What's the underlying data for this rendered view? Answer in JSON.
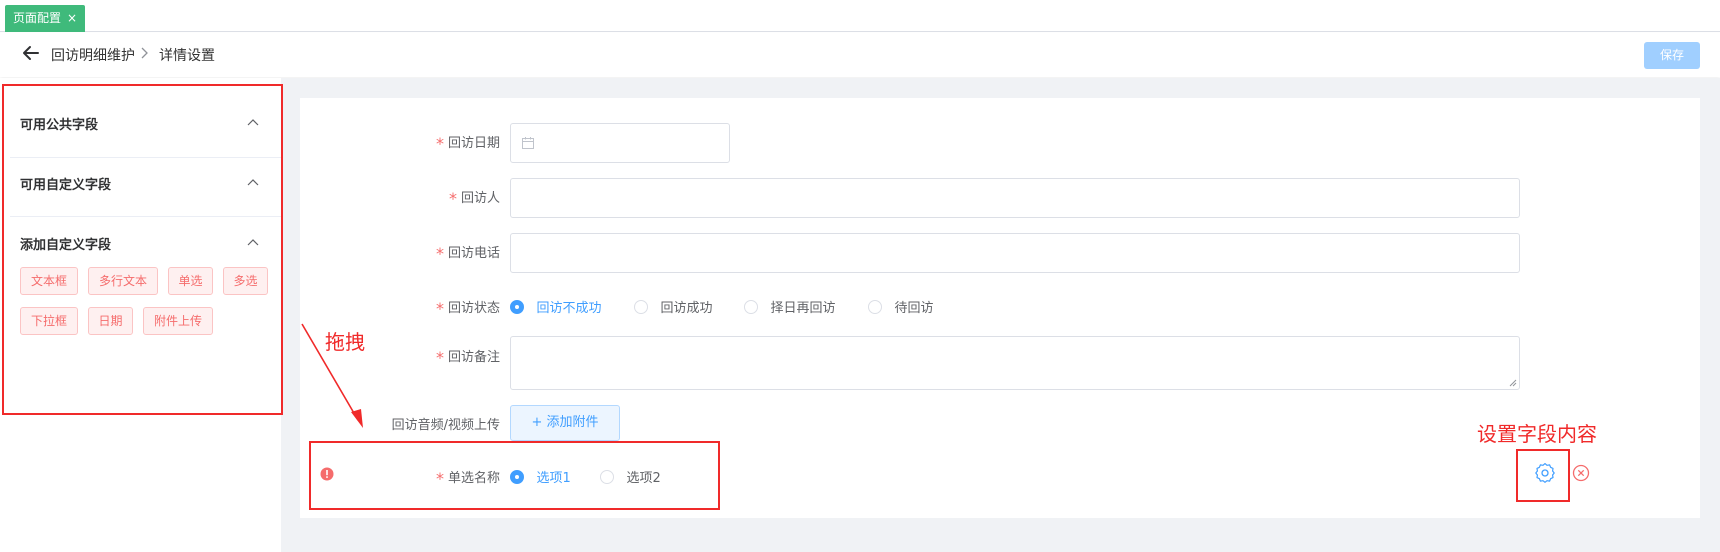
{
  "tabs": [
    {
      "label": "页面配置",
      "close": "×"
    }
  ],
  "breadcrumb": {
    "parent": "回访明细维护",
    "current": "详情设置"
  },
  "toolbar": {
    "save_label": "保存"
  },
  "sidebar": {
    "sections": [
      {
        "title": "可用公共字段"
      },
      {
        "title": "可用自定义字段"
      },
      {
        "title": "添加自定义字段"
      }
    ],
    "chips": [
      "文本框",
      "多行文本",
      "单选",
      "多选",
      "下拉框",
      "日期",
      "附件上传"
    ]
  },
  "form": {
    "required_mark": "*",
    "fields": {
      "visit_date": {
        "label": "回访日期"
      },
      "visitor": {
        "label": "回访人"
      },
      "phone": {
        "label": "回访电话"
      },
      "status": {
        "label": "回访状态",
        "options": [
          "回访不成功",
          "回访成功",
          "择日再回访",
          "待回访"
        ],
        "selected": "回访不成功"
      },
      "remark": {
        "label": "回访备注"
      },
      "media": {
        "label": "回访音频/视频上传",
        "button": "+ 添加附件"
      },
      "single": {
        "label": "单选名称",
        "options": [
          "选项1",
          "选项2"
        ],
        "selected": "选项1"
      }
    }
  },
  "annotations": {
    "drag": "拖拽",
    "set_content": "设置字段内容"
  },
  "colors": {
    "accent": "#409eff",
    "tab": "#3fba7b",
    "annotation": "#f02a2a",
    "required": "#f56c6c"
  }
}
